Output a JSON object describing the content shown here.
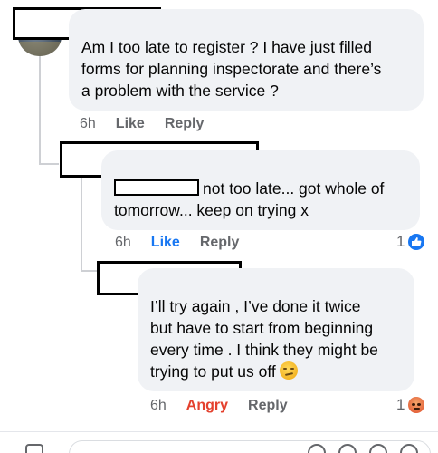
{
  "comments": [
    {
      "text_lines": [
        "Am I too late to register ? I have just filled",
        "forms for planning inspectorate and there’s",
        "a problem with the service ?"
      ],
      "time": "6h",
      "like_label": "Like",
      "reply_label": "Reply"
    },
    {
      "text_after_mention": "not too late... got whole of",
      "text_line2": "tomorrow... keep on trying x",
      "time": "6h",
      "like_label": "Like",
      "reply_label": "Reply",
      "reaction_count": "1",
      "reaction_icon": "like-reaction-icon"
    },
    {
      "text_lines": [
        "I’ll try again , I’ve done it twice",
        "but have to start from beginning",
        "every time . I think they might be",
        "trying to put us off"
      ],
      "time": "6h",
      "reaction_label": "Angry",
      "reply_label": "Reply",
      "reaction_count": "1",
      "reaction_icon": "angry-reaction-icon",
      "emoji": "smirking-face-emoji"
    }
  ],
  "colors": {
    "bubble": "#f0f2f5",
    "meta_text": "#65676b",
    "like_blue": "#1877f2",
    "angry_red": "#e4412e"
  }
}
